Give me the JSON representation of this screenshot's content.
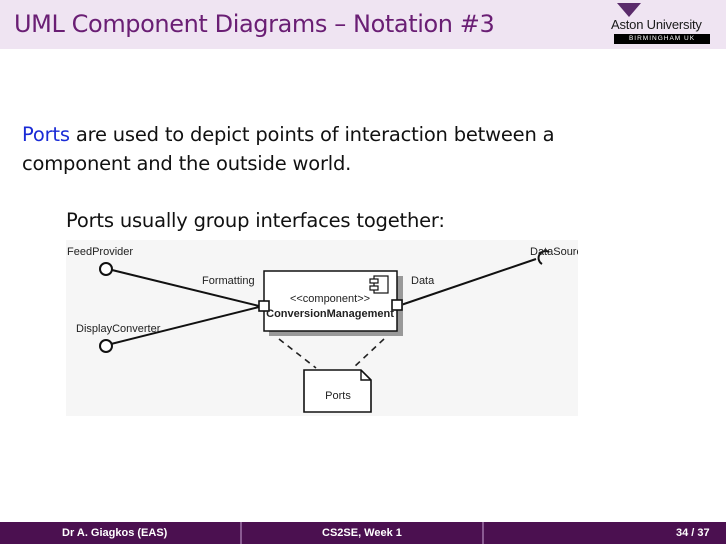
{
  "header": {
    "title": "UML Component Diagrams – Notation #3",
    "logo_name": "Aston University",
    "logo_tagline": "BIRMINGHAM UK"
  },
  "content": {
    "intro_keyword": "Ports",
    "intro_rest": " are used to depict points of interaction between a component and the outside world.",
    "subheading": "Ports usually group interfaces together:"
  },
  "diagram": {
    "feed_provider": "FeedProvider",
    "display_converter": "DisplayConverter",
    "formatting": "Formatting",
    "data_label": "Data",
    "data_source": "DataSource",
    "stereotype": "<<component>>",
    "component_name": "ConversionManagement",
    "note": "Ports"
  },
  "footer": {
    "author": "Dr A. Giagkos  (EAS)",
    "course": "CS2SE, Week 1",
    "page": "34 / 37"
  },
  "colors": {
    "header_bg": "#efe4f2",
    "title": "#6a1e74",
    "keyword": "#1a2bd6",
    "footer_bg": "#4b1050"
  }
}
